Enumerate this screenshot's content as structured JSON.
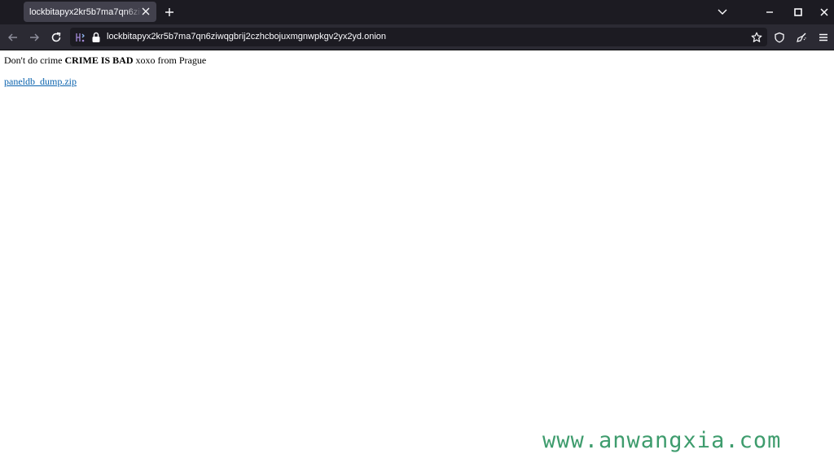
{
  "browser": {
    "tab": {
      "title": "lockbitapyx2kr5b7ma7qn6ziwqgbrij2czhcbojuxmgnwpkgv2yx2yd.onion"
    },
    "url": "lockbitapyx2kr5b7ma7qn6ziwqgbrij2czhcbojuxmgnwpkgv2yx2yd.onion",
    "icons": [
      "back-icon",
      "forward-icon",
      "reload-icon",
      "onion-circuit-icon",
      "lock-icon",
      "bookmark-star-icon",
      "shield-icon",
      "tor-broom-icon",
      "menu-icon",
      "list-all-tabs-icon",
      "minimize-icon",
      "maximize-icon",
      "close-window-icon"
    ]
  },
  "page": {
    "text_before": "Don't do crime ",
    "text_bold": "CRIME IS BAD",
    "text_after": " xoxo from Prague",
    "download_link": "paneldb_dump.zip"
  },
  "watermark": "www.anwangxia.com",
  "colors": {
    "tabstrip_bg": "#1c1b22",
    "navbar_bg": "#2b2a33",
    "link": "#0b63ae",
    "watermark": "#3e9c6d"
  }
}
